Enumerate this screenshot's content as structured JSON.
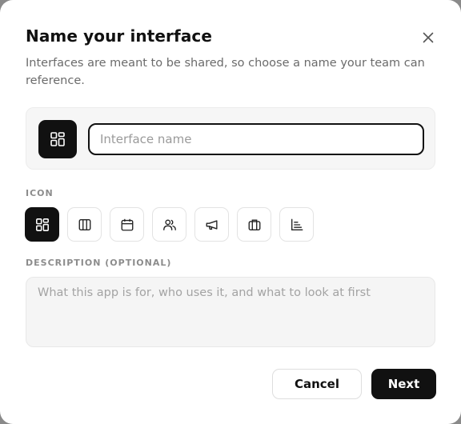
{
  "dialog": {
    "title": "Name your interface",
    "subtitle": "Interfaces are meant to be shared, so choose a name your team can reference.",
    "close_icon": "close-icon"
  },
  "name_field": {
    "placeholder": "Interface name",
    "value": "",
    "selected_icon": "grid-layout-icon"
  },
  "icon_section": {
    "label": "ICON",
    "options": [
      {
        "icon": "grid-layout-icon",
        "selected": true
      },
      {
        "icon": "columns-icon",
        "selected": false
      },
      {
        "icon": "calendar-icon",
        "selected": false
      },
      {
        "icon": "users-icon",
        "selected": false
      },
      {
        "icon": "megaphone-icon",
        "selected": false
      },
      {
        "icon": "briefcase-icon",
        "selected": false
      },
      {
        "icon": "bar-chart-icon",
        "selected": false
      }
    ]
  },
  "description": {
    "label": "DESCRIPTION (OPTIONAL)",
    "placeholder": "What this app is for, who uses it, and what to look at first",
    "value": ""
  },
  "actions": {
    "cancel_label": "Cancel",
    "next_label": "Next"
  },
  "colors": {
    "primary": "#111111",
    "muted_text": "#6b6b6b",
    "surface": "#f6f6f6"
  }
}
